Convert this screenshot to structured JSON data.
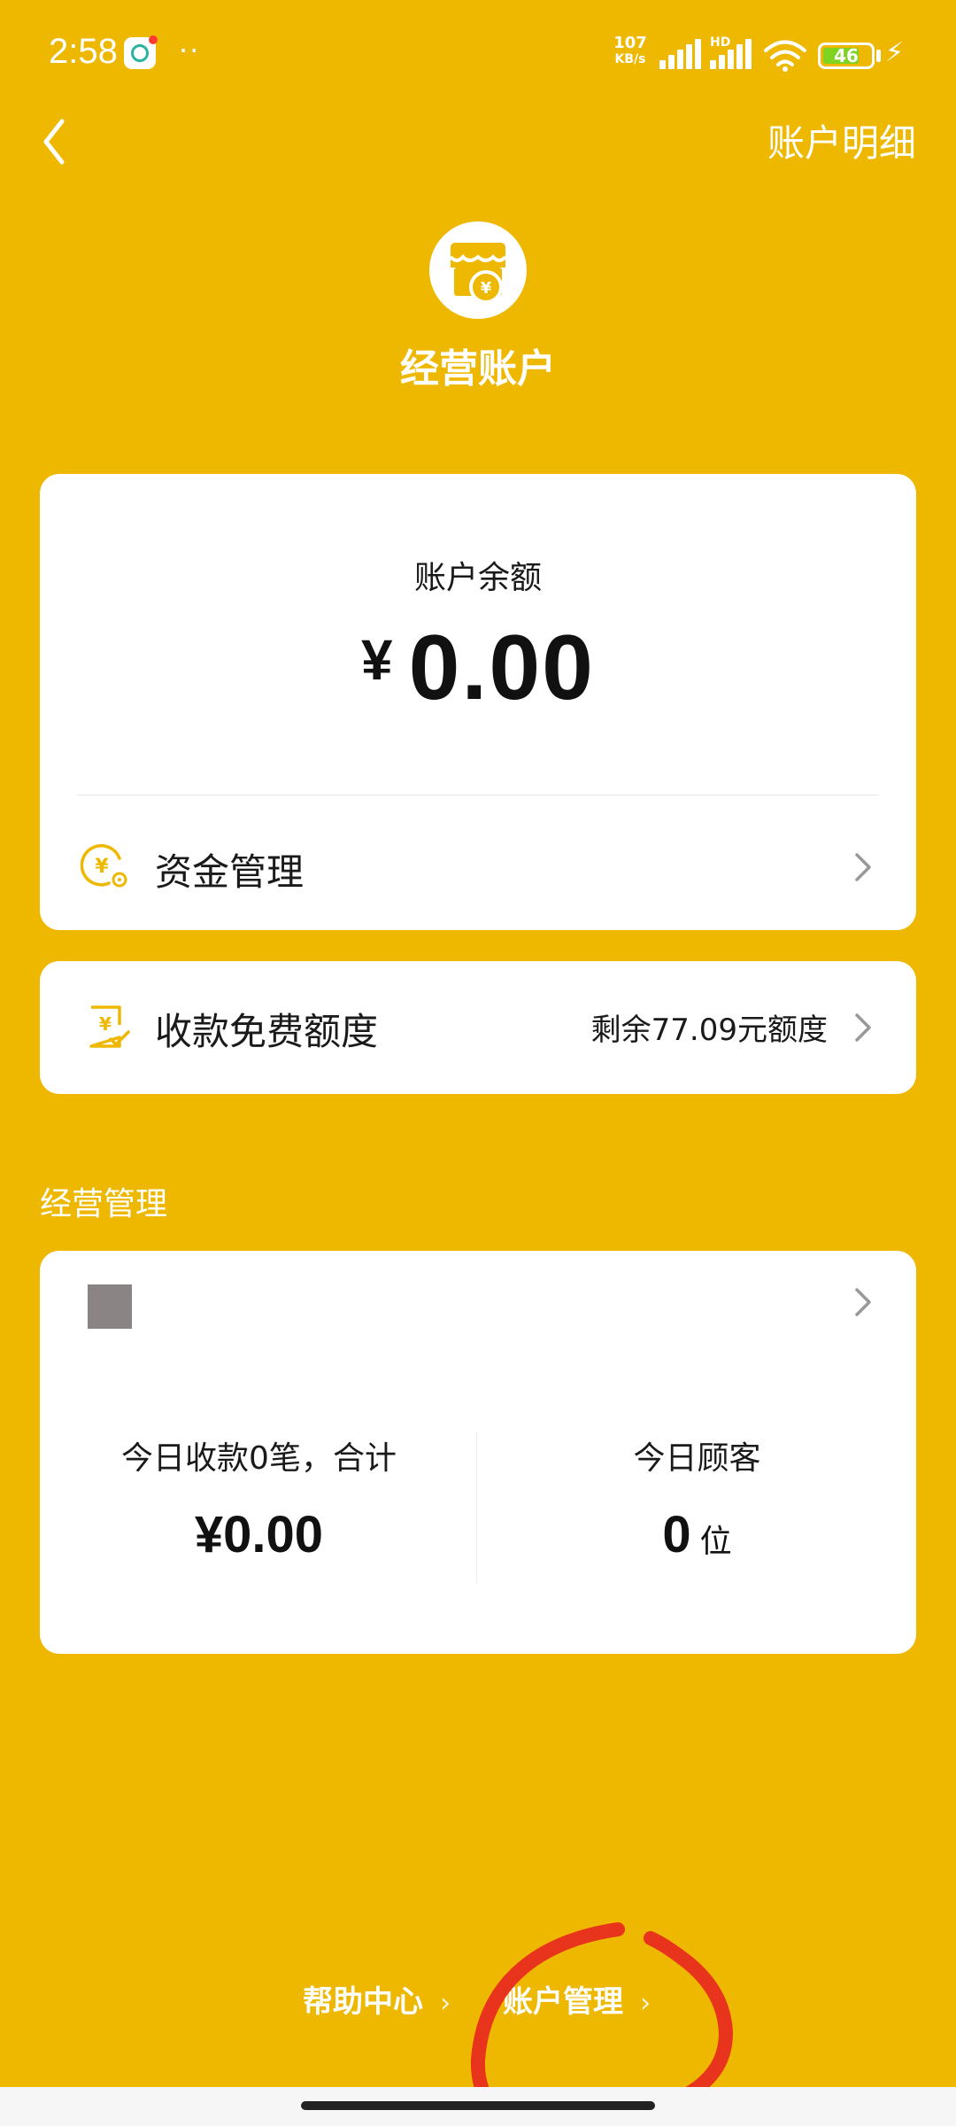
{
  "status_bar": {
    "time": "2:58",
    "dots": "··",
    "net_speed_value": "107",
    "net_speed_unit": "KB/s",
    "hd_label": "HD",
    "battery": "46"
  },
  "header": {
    "account_detail": "账户明细"
  },
  "hero": {
    "title": "经营账户"
  },
  "balance_card": {
    "label": "账户余额",
    "currency": "¥",
    "amount": "0.00",
    "fund_management": "资金管理"
  },
  "quota_card": {
    "label": "收款免费额度",
    "remaining": "剩余77.09元额度"
  },
  "business": {
    "section_title": "经营管理",
    "today_collection_label": "今日收款0笔，合计",
    "today_collection_amount": "¥0.00",
    "today_customers_label": "今日顾客",
    "today_customers_count": "0",
    "today_customers_unit": "位"
  },
  "footer": {
    "help_center": "帮助中心",
    "account_management": "账户管理",
    "chevron": "›"
  },
  "colors": {
    "background": "#EFB800",
    "card": "#FFFFFF",
    "accent_icon": "#EFB800",
    "annotation": "#E8341C"
  },
  "icons": [
    "back-arrow-icon",
    "store-coin-icon",
    "yen-coin-gear-icon",
    "receipt-yen-icon",
    "chevron-right-icon"
  ]
}
